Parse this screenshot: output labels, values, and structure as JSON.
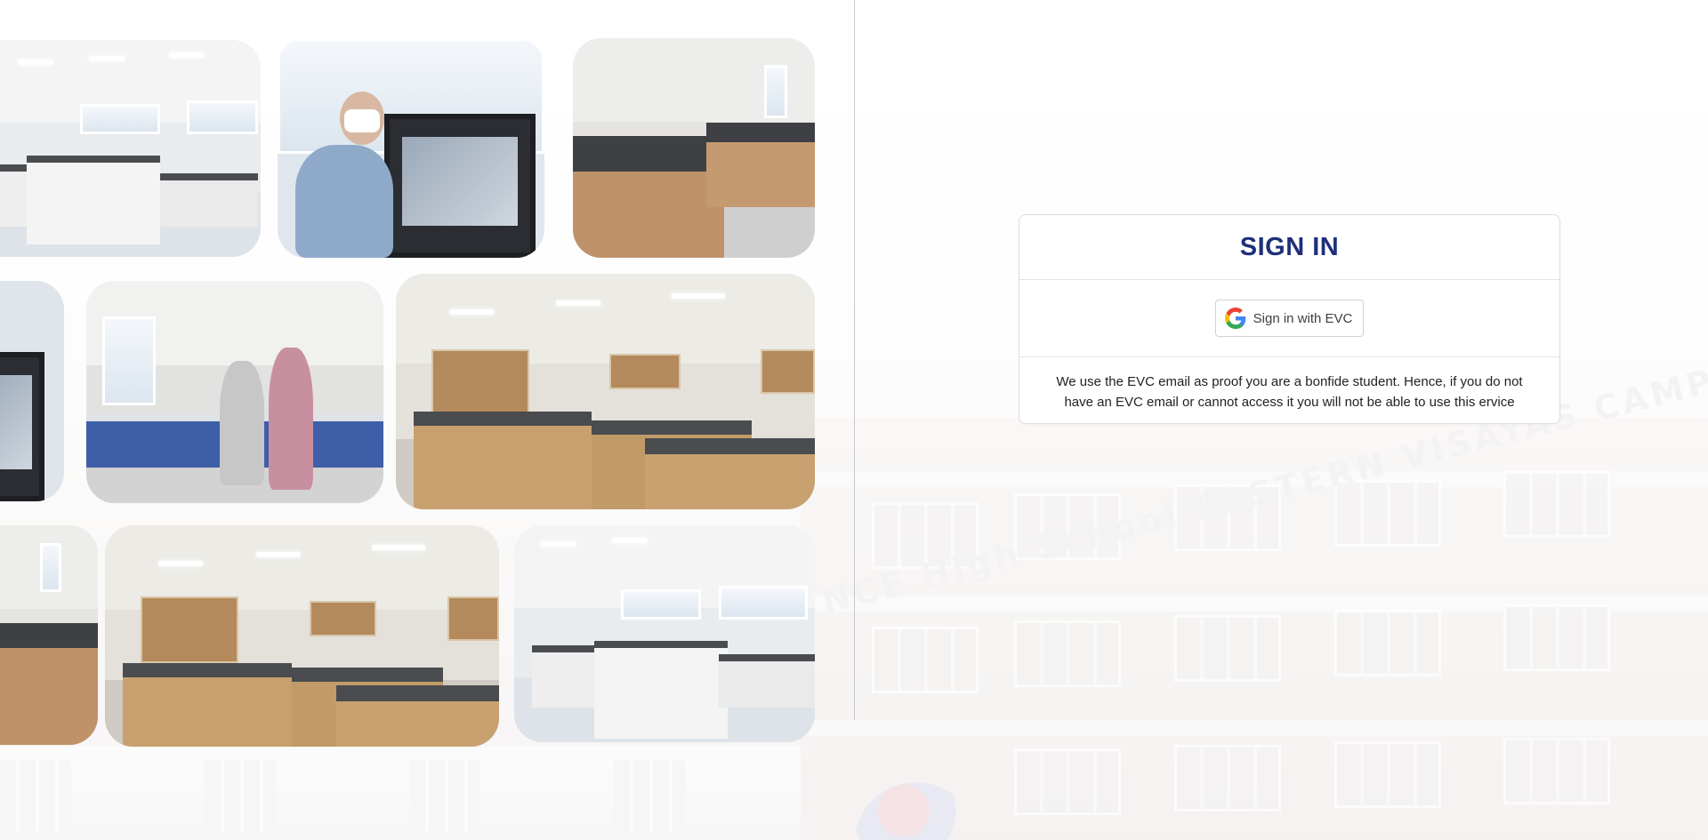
{
  "background": {
    "campus_sign": "NCE High School EASTERN VISAYAS CAMPUS"
  },
  "gallery": {
    "photos": [
      {
        "subject": "lab-room-white-benches"
      },
      {
        "subject": "person-with-3d-printer"
      },
      {
        "subject": "lab-room-wood-benches"
      },
      {
        "subject": "printer-closeup"
      },
      {
        "subject": "two-people-in-lab"
      },
      {
        "subject": "chemistry-lab-cabinets"
      },
      {
        "subject": "lab-room-wood-benches-crop"
      },
      {
        "subject": "chemistry-lab-cabinets-2"
      },
      {
        "subject": "lab-room-white-benches-2"
      }
    ]
  },
  "signin": {
    "title": "SIGN IN",
    "google_button": {
      "icon": "google-g-icon",
      "label": "Sign in with EVC"
    },
    "notice": "We use the EVC email as proof you are a bonfide student. Hence, if you do not have an EVC email or cannot access it you will not be able to use this ervice"
  },
  "colors": {
    "title": "#1f2f7a",
    "google_blue": "#4285F4",
    "google_red": "#EA4335",
    "google_yellow": "#FBBC05",
    "google_green": "#34A853"
  }
}
